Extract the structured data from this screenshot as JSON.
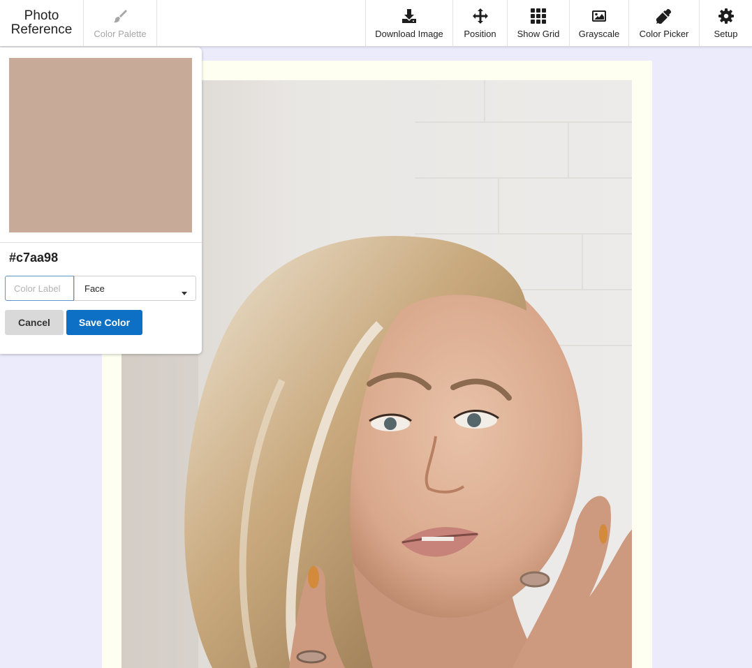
{
  "brand": {
    "line1": "Photo",
    "line2": "Reference"
  },
  "toolbar": {
    "color_palette": {
      "label": "Color Palette",
      "icon": "paintbrush-icon",
      "disabled": true
    },
    "download": {
      "label": "Download Image",
      "icon": "download-icon"
    },
    "position": {
      "label": "Position",
      "icon": "move-arrows-icon"
    },
    "grid": {
      "label": "Show Grid",
      "icon": "grid-icon"
    },
    "grayscale": {
      "label": "Grayscale",
      "icon": "image-icon"
    },
    "picker": {
      "label": "Color Picker",
      "icon": "eyedropper-icon"
    },
    "setup": {
      "label": "Setup",
      "icon": "gear-icon"
    }
  },
  "popup": {
    "swatch_color": "#c7aa98",
    "hex": "#c7aa98",
    "label_placeholder": "Color Label",
    "label_value": "",
    "category_selected": "Face",
    "cancel_label": "Cancel",
    "save_label": "Save Color"
  },
  "photo": {
    "subject": "reference-photo",
    "frame_color": "#fefff0"
  },
  "colors": {
    "background": "#ebebfc",
    "accent": "#0d70c4",
    "input_border": "#5c95c9"
  }
}
